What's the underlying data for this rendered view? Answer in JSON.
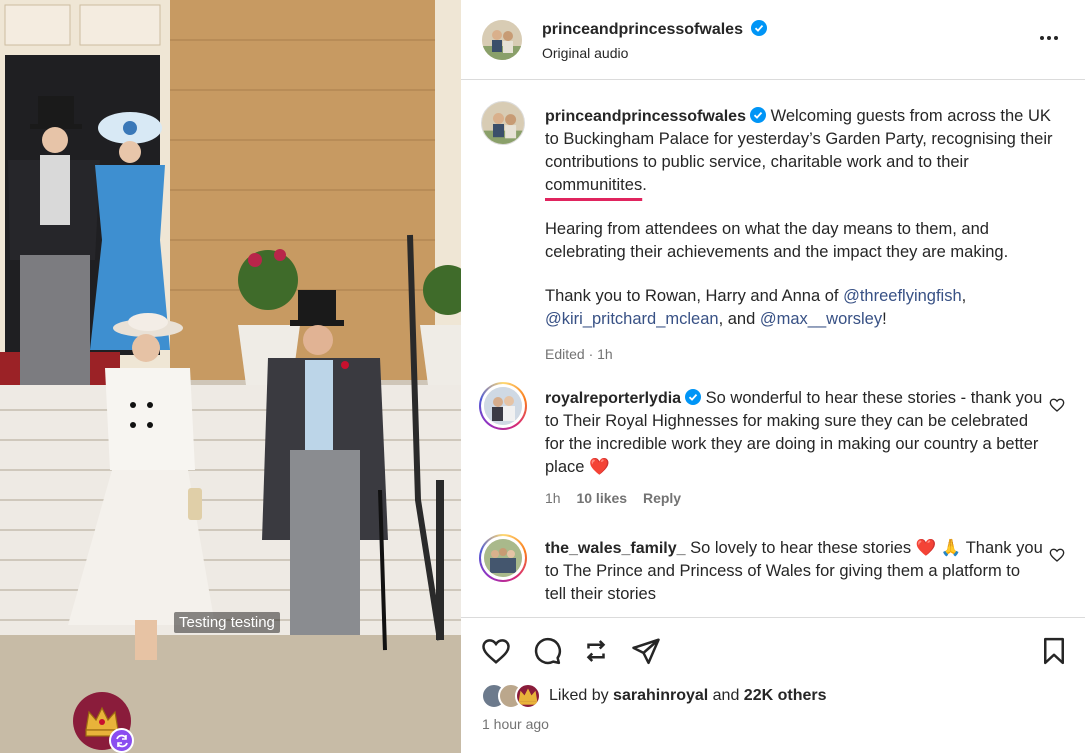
{
  "media": {
    "overlay_caption": "Testing testing"
  },
  "post": {
    "username": "princeandprincessofwales",
    "audio": "Original audio",
    "caption": {
      "p1_prefix": "Welcoming guests from across the UK to Buckingham Palace for yesterday’s Garden Party, recognising their contributions to public service, charitable work and to their ",
      "p1_misspelled": "communitites",
      "p1_suffix": ".",
      "p2": "Hearing from attendees on what the day means to them, and celebrating their achievements and the impact they are making.",
      "p3_prefix": "Thank you to Rowan, Harry and Anna of ",
      "mention1": "@threeflyingfish",
      "p3_comma": ",",
      "mention2": "@kiri_pritchard_mclean",
      "p3_and": ", and ",
      "mention3": "@max__worsley",
      "p3_suffix": "!"
    },
    "edited": "Edited · 1h"
  },
  "comments": [
    {
      "username": "royalreporterlydia",
      "verified": true,
      "text": "So wonderful to hear these stories - thank you to Their Royal Highnesses for making sure they can be celebrated for the incredible work they are doing in making our country a better place ❤️",
      "time": "1h",
      "likes": "10 likes",
      "reply": "Reply"
    },
    {
      "username": "the_wales_family_",
      "verified": false,
      "text": "So lovely to hear these stories ❤️ 🙏 Thank you to The Prince and Princess of Wales for giving them a platform to tell their stories"
    }
  ],
  "actions": {
    "icons": [
      "heart-icon",
      "comment-icon",
      "repost-icon",
      "share-icon",
      "bookmark-icon"
    ],
    "liked_prefix": "Liked by ",
    "liked_user": "sarahinroyal",
    "liked_and": " and ",
    "liked_others": "22K others",
    "timestamp": "1 hour ago"
  },
  "colors": {
    "verified_blue": "#0095f6",
    "mention_blue": "#385185",
    "misspell_underline": "#e0245e",
    "muted": "#737373",
    "divider": "#dbdbdb"
  }
}
